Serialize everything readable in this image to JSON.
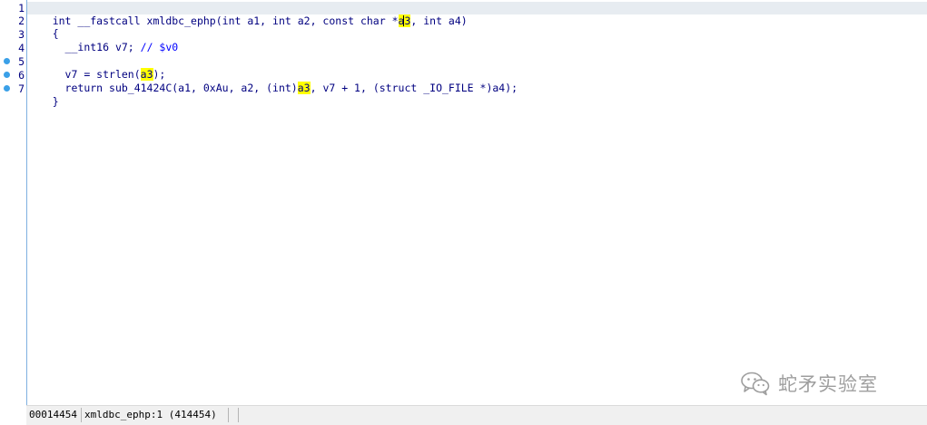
{
  "editor": {
    "lines": [
      {
        "num": "1",
        "breakpoint": false
      },
      {
        "num": "2",
        "breakpoint": false,
        "text": "{"
      },
      {
        "num": "3",
        "breakpoint": false
      },
      {
        "num": "4",
        "breakpoint": false,
        "text": ""
      },
      {
        "num": "5",
        "breakpoint": true
      },
      {
        "num": "6",
        "breakpoint": true
      },
      {
        "num": "7",
        "breakpoint": true,
        "text": "}"
      }
    ],
    "line1": {
      "p1": "int __fastcall xmldbc_ephp(int a1, int a2, const char *",
      "hl_a": "a",
      "hl_b": "3",
      "p2": ", int a4)"
    },
    "line3": {
      "p1": "  __int16 v7; ",
      "comment": "// $v0"
    },
    "line5": {
      "p1": "  v7 = strlen(",
      "hl": "a3",
      "p2": ");"
    },
    "line6": {
      "p1": "  return sub_41424C(a1, 0xAu, a2, (int)",
      "hl": "a3",
      "p2": ", v7 + 1, (struct _IO_FILE *)a4);"
    }
  },
  "status": {
    "address": "00014454",
    "location": "xmldbc_ephp:1 (414454)"
  },
  "watermark": {
    "icon": "wechat-icon",
    "text": "蛇矛实验室"
  },
  "colors": {
    "code": "#000080",
    "comment": "#0000ff",
    "highlight": "#ffff00",
    "current_line": "#e7ecf1",
    "breakpoint": "#3aa0e8"
  }
}
